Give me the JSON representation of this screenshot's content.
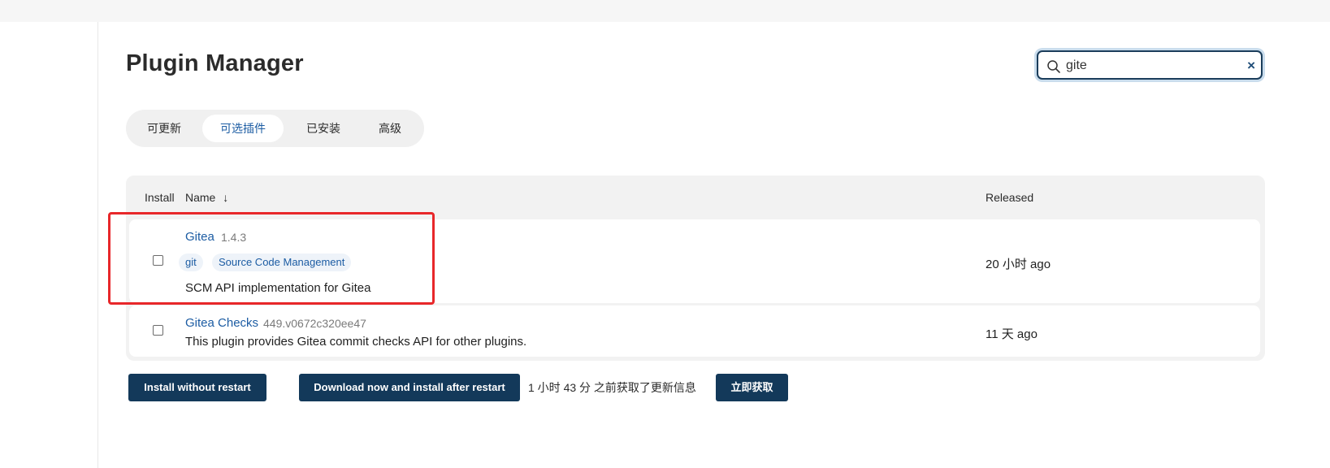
{
  "page": {
    "title": "Plugin Manager"
  },
  "search": {
    "value": "gite",
    "clear_label": "×"
  },
  "tabs": [
    {
      "label": "可更新",
      "active": false
    },
    {
      "label": "可选插件",
      "active": true
    },
    {
      "label": "已安装",
      "active": false
    },
    {
      "label": "高级",
      "active": false
    }
  ],
  "table": {
    "headers": {
      "install": "Install",
      "name": "Name",
      "sort_indicator": "↓",
      "released": "Released"
    },
    "rows": [
      {
        "name": "Gitea",
        "version": "1.4.3",
        "tags": [
          "git",
          "Source Code Management"
        ],
        "description": "SCM API implementation for Gitea",
        "released": "20 小时 ago",
        "checked": false
      },
      {
        "name": "Gitea Checks",
        "version": "449.v0672c320ee47",
        "tags": [],
        "description": "This plugin provides Gitea commit checks API for other plugins.",
        "released": "11 天 ago",
        "checked": false
      }
    ]
  },
  "actions": {
    "install_without_restart": "Install without restart",
    "download_install_after_restart": "Download now and install after restart",
    "update_info": "1 小时 43 分 之前获取了更新信息",
    "fetch_now": "立即获取"
  },
  "colors": {
    "accent": "#1c5ca3",
    "button_bg": "#13395a",
    "highlight_box": "#e8272a",
    "search_border": "#1b3d5b"
  },
  "icons": {
    "search": "search-icon",
    "clear": "close-icon",
    "sort": "arrow-down-icon"
  }
}
